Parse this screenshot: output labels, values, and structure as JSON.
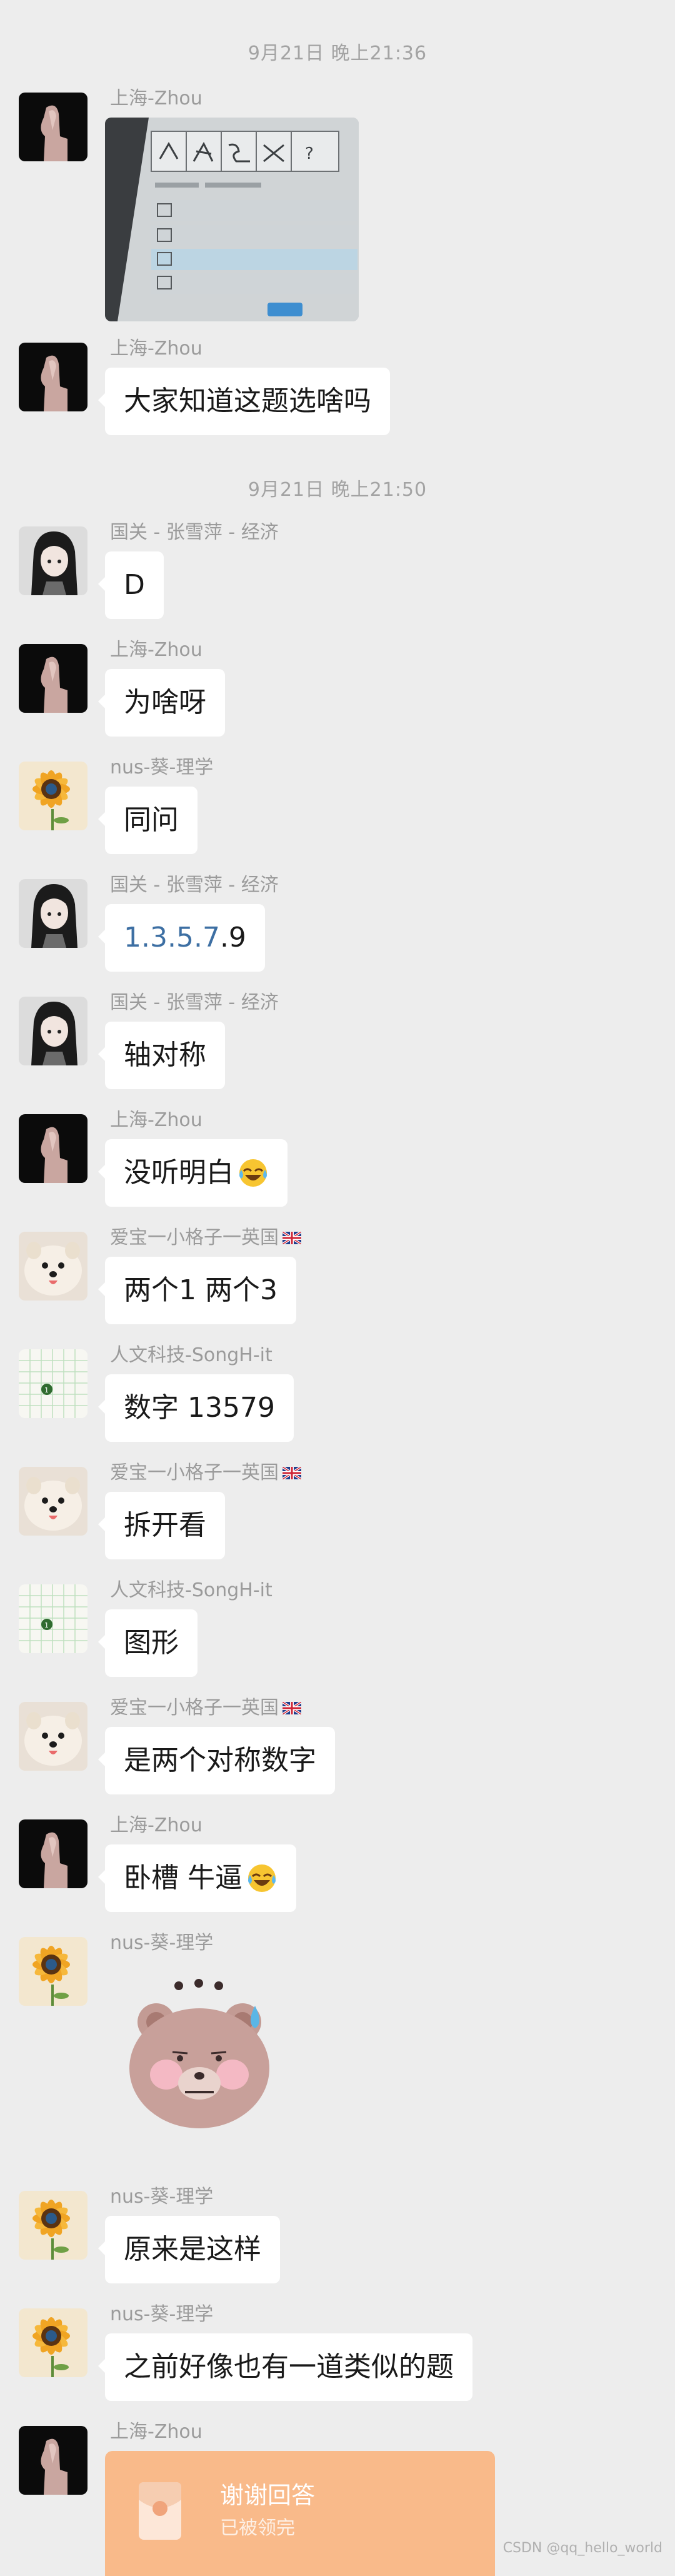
{
  "timestamps": [
    "9月21日 晚上21:36",
    "9月21日 晚上21:50"
  ],
  "senders": {
    "zhou": "上海-Zhou",
    "zhang": "国关 - 张雪萍 - 经济",
    "kui": "nus-葵-理学",
    "aibao": "爱宝一小格子一英国",
    "song": "人文科技-SongH-it"
  },
  "messages": [
    {
      "sender_key": "zhou",
      "type": "image",
      "content": ""
    },
    {
      "sender_key": "zhou",
      "type": "text",
      "content": "大家知道这题选啥吗"
    },
    {
      "sender_key": "zhang",
      "type": "text",
      "content": "D"
    },
    {
      "sender_key": "zhou",
      "type": "text",
      "content": "为啥呀"
    },
    {
      "sender_key": "kui",
      "type": "text",
      "content": "同问"
    },
    {
      "sender_key": "zhang",
      "type": "text",
      "content_link": "1.3.5.7",
      "content_rest": ".9"
    },
    {
      "sender_key": "zhang",
      "type": "text",
      "content": "轴对称"
    },
    {
      "sender_key": "zhou",
      "type": "text",
      "content": "没听明白",
      "emoji": "laugh-cry-emoji"
    },
    {
      "sender_key": "aibao",
      "type": "text",
      "content": "两个1 两个3"
    },
    {
      "sender_key": "song",
      "type": "text",
      "content": "数字 13579"
    },
    {
      "sender_key": "aibao",
      "type": "text",
      "content": "拆开看"
    },
    {
      "sender_key": "song",
      "type": "text",
      "content": "图形"
    },
    {
      "sender_key": "aibao",
      "type": "text",
      "content": "是两个对称数字"
    },
    {
      "sender_key": "zhou",
      "type": "text",
      "content": "卧槽 牛逼",
      "emoji": "laugh-cry-emoji"
    },
    {
      "sender_key": "kui",
      "type": "sticker",
      "content": "bear-sweat-sticker"
    },
    {
      "sender_key": "kui",
      "type": "text",
      "content": "原来是这样"
    },
    {
      "sender_key": "kui",
      "type": "text",
      "content": "之前好像也有一道类似的题"
    },
    {
      "sender_key": "zhou",
      "type": "red_packet",
      "title": "谢谢回答",
      "subtitle": "已被领完"
    }
  ],
  "watermark": "CSDN @qq_hello_world",
  "colors": {
    "background": "#ededed",
    "bubble": "#ffffff",
    "link_blue": "#3d6fa3",
    "red_packet": "#f9ba8a"
  }
}
